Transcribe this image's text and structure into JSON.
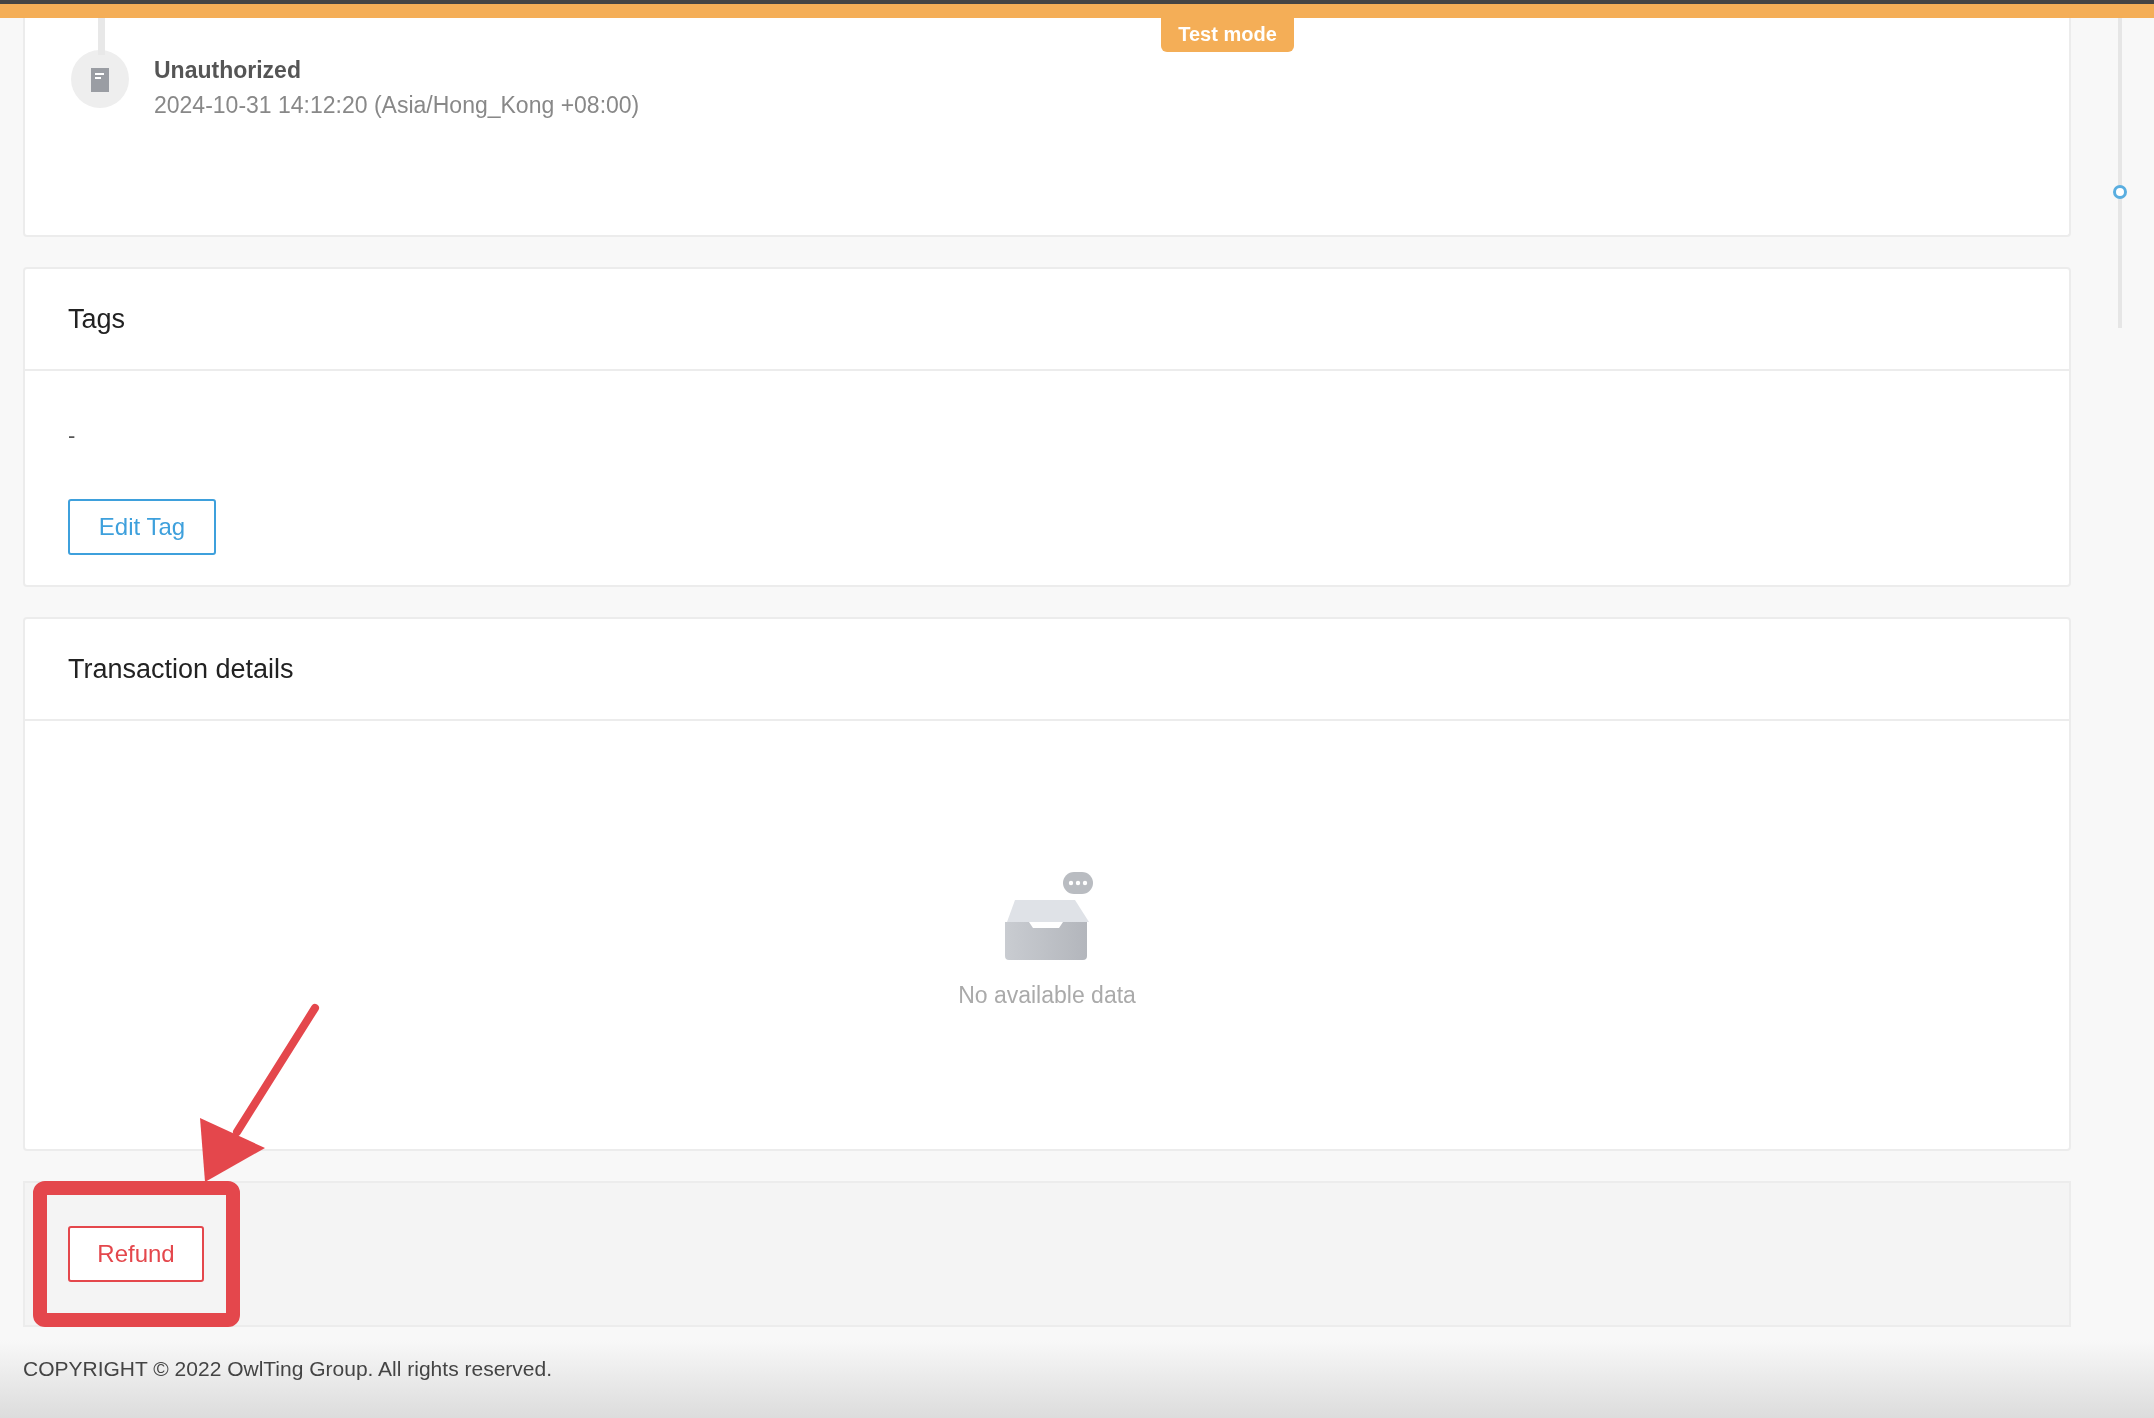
{
  "header": {
    "badge": "Test mode"
  },
  "timeline": {
    "status": "Unauthorized",
    "time": "2024-10-31 14:12:20 (Asia/Hong_Kong +08:00)"
  },
  "tags_card": {
    "title": "Tags",
    "value": "-",
    "button": "Edit Tag"
  },
  "transactions_card": {
    "title": "Transaction details",
    "empty_text": "No available data"
  },
  "actions": {
    "refund_button": "Refund"
  },
  "footer": {
    "copyright": "COPYRIGHT © 2022 OwlTing Group. All rights reserved."
  }
}
